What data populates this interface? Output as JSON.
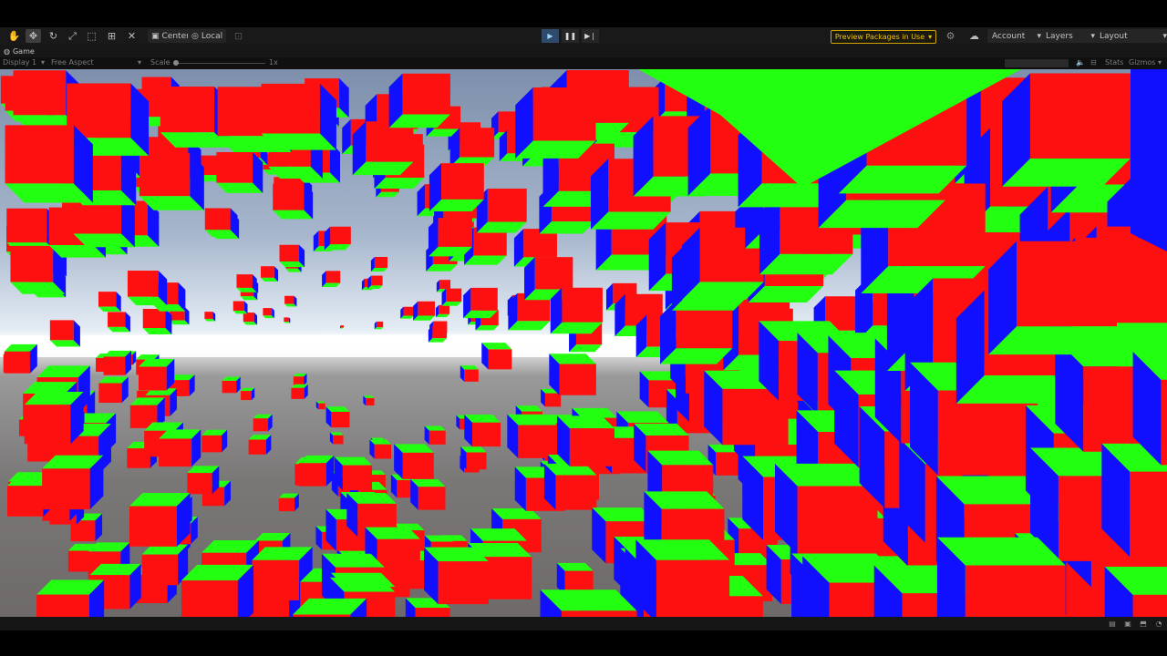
{
  "toolbar": {
    "transform_tools": [
      "hand-tool-icon",
      "move-tool-icon",
      "rotate-tool-icon",
      "scale-tool-icon",
      "rect-tool-icon",
      "transform-tool-icon",
      "custom-tool-icon"
    ],
    "pivot_label": "Center",
    "space_label": "Local",
    "preview_packages_label": "Preview Packages in Use",
    "account_label": "Account",
    "layers_label": "Layers",
    "layout_label": "Layout"
  },
  "game_view": {
    "tab_label": "Game",
    "display_label": "Display 1",
    "aspect_label": "Free Aspect",
    "scale_label": "Scale",
    "scale_value": "1x",
    "right_label_1": "Stats",
    "right_label_2": "Gizmos"
  },
  "colors": {
    "cube_top": "#23ff10",
    "cube_front": "#ff1010",
    "cube_side": "#1010ff",
    "accent_warning": "#f2c200"
  }
}
